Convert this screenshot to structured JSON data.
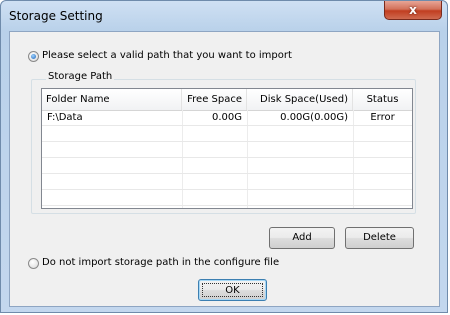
{
  "window": {
    "title": "Storage Setting",
    "close_glyph": "x"
  },
  "options": {
    "import_label": "Please select a valid path that you want to import",
    "import_selected": true,
    "no_import_label": "Do not import storage path in the configure file",
    "no_import_selected": false
  },
  "storage": {
    "group_title": "Storage Path",
    "columns": [
      "Folder Name",
      "Free Space",
      "Disk Space(Used)",
      "Status"
    ],
    "rows": [
      {
        "folder": "F:\\Data",
        "free": "0.00G",
        "disk": "0.00G(0.00G)",
        "status": "Error"
      }
    ]
  },
  "buttons": {
    "add": "Add",
    "delete": "Delete",
    "ok": "OK"
  },
  "icons": {
    "close": "close-icon",
    "radio_on": "radio-checked-icon",
    "radio_off": "radio-unchecked-icon"
  }
}
